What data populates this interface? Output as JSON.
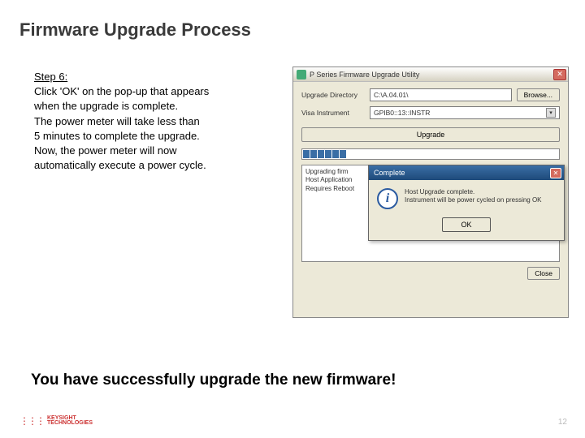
{
  "title": "Firmware Upgrade Process",
  "step": {
    "label": "Step 6:",
    "lines": [
      "Click 'OK' on the pop-up that appears",
      "when the upgrade is complete.",
      "The power meter will take less than",
      "5 minutes to complete the upgrade.",
      "Now, the power meter will now",
      "automatically execute a power cycle."
    ]
  },
  "success": "You have successfully upgrade the new firmware!",
  "page_number": "12",
  "brand": {
    "name": "KEYSIGHT",
    "sub": "TECHNOLOGIES"
  },
  "app": {
    "title": "P Series Firmware Upgrade Utility",
    "labels": {
      "upgrade_dir": "Upgrade Directory",
      "visa_instrument": "Visa Instrument"
    },
    "fields": {
      "upgrade_dir_value": "C:\\A.04.01\\",
      "visa_value": "GPIB0::13::INSTR"
    },
    "buttons": {
      "browse": "Browse...",
      "upgrade": "Upgrade",
      "close": "Close"
    },
    "status_lines": [
      "Upgrading firm",
      "Host Application",
      "Requires Reboot"
    ]
  },
  "dialog": {
    "title": "Complete",
    "lines": [
      "Host Upgrade complete.",
      "Instrument will be power cycled on pressing OK"
    ],
    "ok": "OK"
  }
}
